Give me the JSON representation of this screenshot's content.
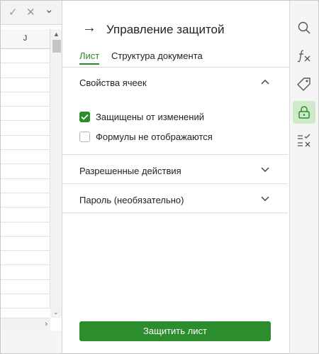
{
  "sheet": {
    "confirm_glyph": "✓",
    "cancel_glyph": "✕",
    "dropdown_glyph": "⌄",
    "column_header": "J",
    "row_count": 18,
    "scroll_up_glyph": "▲",
    "scroll_down_glyph": "⌄",
    "scroll_right_glyph": "›"
  },
  "panel": {
    "back_glyph": "→",
    "title": "Управление защитой",
    "tabs": [
      {
        "label": "Лист",
        "active": true
      },
      {
        "label": "Структура документа",
        "active": false
      }
    ],
    "sections": {
      "cell_properties": {
        "title": "Свойства ячеек",
        "expanded": true,
        "options": [
          {
            "label": "Защищены от изменений",
            "checked": true
          },
          {
            "label": "Формулы не отображаются",
            "checked": false
          }
        ]
      },
      "allowed_actions": {
        "title": "Разрешенные действия",
        "expanded": false
      },
      "password": {
        "title": "Пароль (необязательно)",
        "expanded": false
      }
    },
    "protect_button": "Защитить лист"
  },
  "toolbar": {
    "items": [
      {
        "icon": "search-icon",
        "active": false
      },
      {
        "icon": "function-icon",
        "active": false
      },
      {
        "icon": "tag-icon",
        "active": false
      },
      {
        "icon": "lock-icon",
        "active": true
      },
      {
        "icon": "checklist-icon",
        "active": false
      }
    ],
    "accent": "#2c8d2c"
  }
}
